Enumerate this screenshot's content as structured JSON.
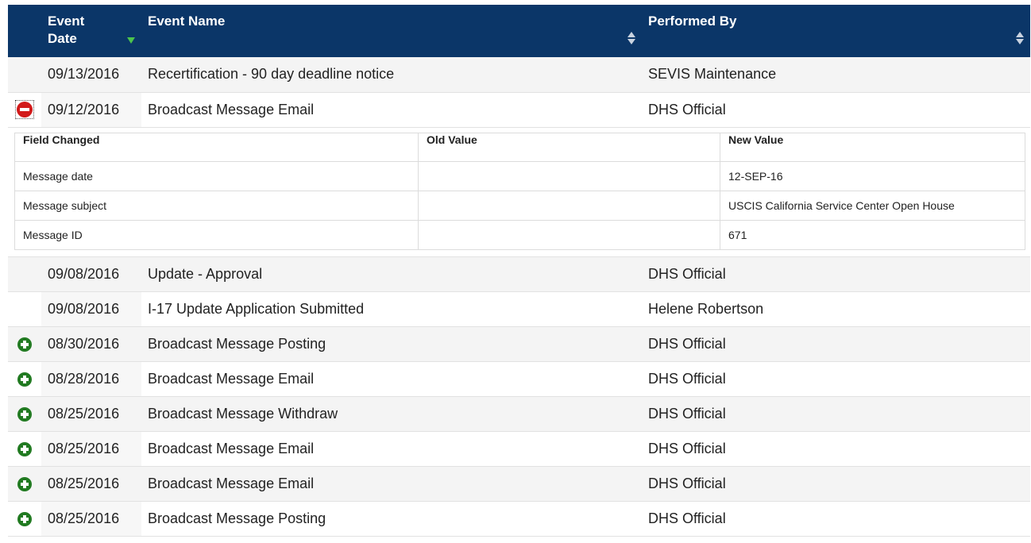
{
  "columns": {
    "event_date": "Event Date",
    "event_name": "Event Name",
    "performed_by": "Performed By"
  },
  "colors": {
    "header_bg": "#0b3668",
    "expand_icon": "#217a21",
    "collapse_icon": "#d21a1a",
    "sort_active": "#4cc44c"
  },
  "rows": [
    {
      "toggle": "none",
      "date": "09/13/2016",
      "name": "Recertification - 90 day deadline notice",
      "by": "SEVIS Maintenance"
    },
    {
      "toggle": "collapse-icon",
      "date": "09/12/2016",
      "name": "Broadcast Message Email",
      "by": "DHS Official"
    },
    {
      "toggle": "none",
      "date": "09/08/2016",
      "name": "Update - Approval",
      "by": "DHS Official"
    },
    {
      "toggle": "none",
      "date": "09/08/2016",
      "name": "I-17 Update Application Submitted",
      "by": "Helene Robertson"
    },
    {
      "toggle": "expand-icon",
      "date": "08/30/2016",
      "name": "Broadcast Message Posting",
      "by": "DHS Official"
    },
    {
      "toggle": "expand-icon",
      "date": "08/28/2016",
      "name": "Broadcast Message Email",
      "by": "DHS Official"
    },
    {
      "toggle": "expand-icon",
      "date": "08/25/2016",
      "name": "Broadcast Message Withdraw",
      "by": "DHS Official"
    },
    {
      "toggle": "expand-icon",
      "date": "08/25/2016",
      "name": "Broadcast Message Email",
      "by": "DHS Official"
    },
    {
      "toggle": "expand-icon",
      "date": "08/25/2016",
      "name": "Broadcast Message Email",
      "by": "DHS Official"
    },
    {
      "toggle": "expand-icon",
      "date": "08/25/2016",
      "name": "Broadcast Message Posting",
      "by": "DHS Official"
    }
  ],
  "detail": {
    "headers": {
      "field": "Field Changed",
      "old": "Old Value",
      "new": "New Value"
    },
    "rows": [
      {
        "field": "Message date",
        "old": "",
        "new": "12-SEP-16"
      },
      {
        "field": "Message subject",
        "old": "",
        "new": "USCIS California Service Center Open House"
      },
      {
        "field": "Message ID",
        "old": "",
        "new": "671"
      }
    ]
  }
}
